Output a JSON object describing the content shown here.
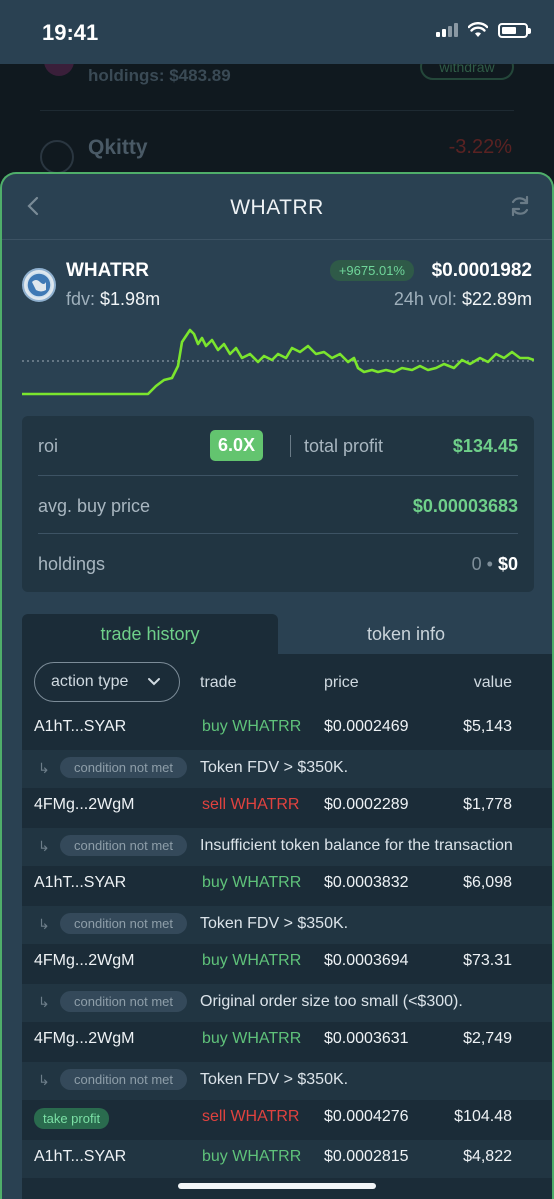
{
  "status_bar": {
    "time": "19:41"
  },
  "background": {
    "holdings": "holdings: $483.89",
    "withdraw_label": "withdraw",
    "token": "Qkitty",
    "change": "-3.22%"
  },
  "sheet": {
    "title": "WHATRR",
    "token": {
      "name": "WHATRR",
      "fdv_label": "fdv:",
      "fdv_value": "$1.98m",
      "change": "+9675.01%",
      "price": "$0.0001982",
      "vol_label": "24h vol:",
      "vol_value": "$22.89m"
    },
    "stats": {
      "roi_label": "roi",
      "roi_value": "6.0X",
      "total_profit_label": "total profit",
      "total_profit_value": "$134.45",
      "avg_buy_label": "avg. buy price",
      "avg_buy_value": "$0.00003683",
      "holdings_label": "holdings",
      "holdings_qty": "0",
      "holdings_value": "$0"
    },
    "tabs": [
      {
        "label": "trade history",
        "active": true
      },
      {
        "label": "token info",
        "active": false
      }
    ],
    "history": {
      "filter_label": "action type",
      "columns": {
        "trade": "trade",
        "price": "price",
        "value": "value"
      },
      "condition_label": "condition not met",
      "take_profit_label": "take profit",
      "rows": [
        {
          "wallet": "A1hT...SYAR",
          "trade": "buy WHATRR",
          "side": "buy",
          "price": "$0.0002469",
          "value": "$5,143",
          "condition": "Token FDV > $350K."
        },
        {
          "wallet": "4FMg...2WgM",
          "trade": "sell WHATRR",
          "side": "sell",
          "price": "$0.0002289",
          "value": "$1,778",
          "condition": "Insufficient token balance for the transaction"
        },
        {
          "wallet": "A1hT...SYAR",
          "trade": "buy WHATRR",
          "side": "buy",
          "price": "$0.0003832",
          "value": "$6,098",
          "condition": "Token FDV > $350K."
        },
        {
          "wallet": "4FMg...2WgM",
          "trade": "buy WHATRR",
          "side": "buy",
          "price": "$0.0003694",
          "value": "$73.31",
          "condition": "Original order size too small (<$300)."
        },
        {
          "wallet": "4FMg...2WgM",
          "trade": "buy WHATRR",
          "side": "buy",
          "price": "$0.0003631",
          "value": "$2,749",
          "condition": "Token FDV > $350K."
        },
        {
          "wallet": "",
          "trade": "sell WHATRR",
          "side": "sell",
          "price": "$0.0004276",
          "value": "$104.48",
          "condition": ""
        },
        {
          "wallet": "A1hT...SYAR",
          "trade": "buy WHATRR",
          "side": "buy",
          "price": "$0.0002815",
          "value": "$4,822",
          "condition": ""
        }
      ]
    }
  },
  "colors": {
    "accent_green": "#6fd08a",
    "sell_red": "#e0423f",
    "chart_line": "#7be52e"
  }
}
